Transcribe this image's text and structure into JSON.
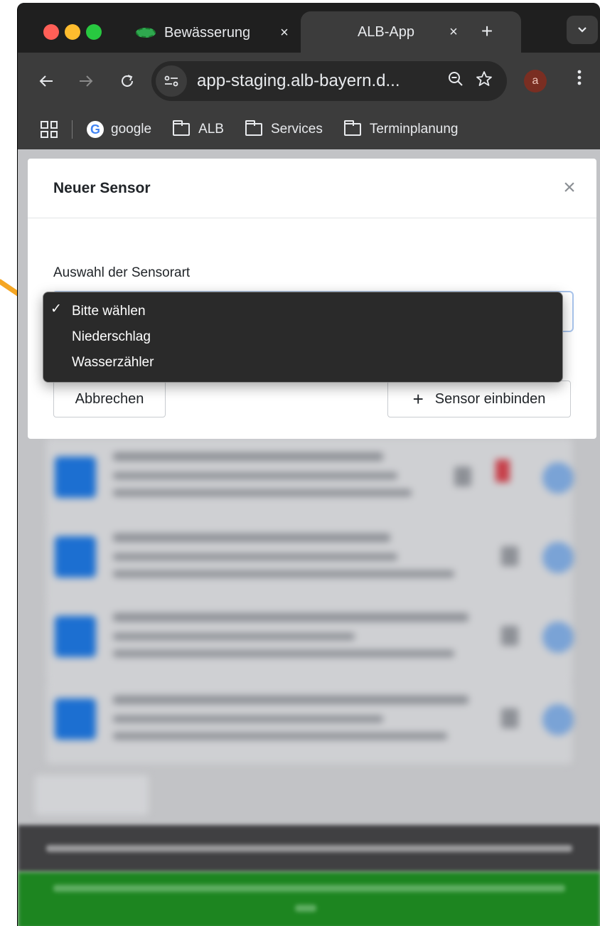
{
  "browser": {
    "tabs": [
      {
        "title": "Bewässerung",
        "active": false
      },
      {
        "title": "ALB-App",
        "active": true
      }
    ],
    "tab_close_glyph": "×",
    "new_tab_glyph": "+",
    "tab_list_glyph": "⌄",
    "url": "app-staging.alb-bayern.d...",
    "profile_initial": "a",
    "bookmarks": [
      {
        "label": "google",
        "icon": "google-icon"
      },
      {
        "label": "ALB",
        "icon": "folder-icon"
      },
      {
        "label": "Services",
        "icon": "folder-icon"
      },
      {
        "label": "Terminplanung",
        "icon": "folder-icon"
      }
    ]
  },
  "modal": {
    "title": "Neuer Sensor",
    "close_glyph": "×",
    "field_label": "Auswahl der Sensorart",
    "cancel_label": "Abbrechen",
    "submit_label": "Sensor einbinden",
    "submit_icon": "+"
  },
  "dropdown": {
    "options": [
      "Bitte wählen",
      "Niederschlag",
      "Wasserzähler"
    ],
    "selected_index": 0,
    "check_glyph": "✓"
  },
  "colors": {
    "annotation_arrow": "#f5a623",
    "select_focus_border": "#a8c4ec"
  }
}
